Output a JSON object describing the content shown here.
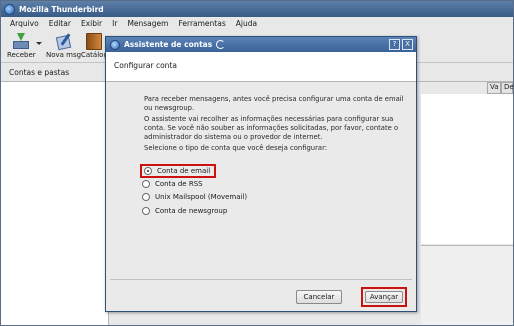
{
  "app": {
    "title": "Mozilla Thunderbird",
    "menu": [
      "Arquivo",
      "Editar",
      "Exibir",
      "Ir",
      "Mensagem",
      "Ferramentas",
      "Ajuda"
    ],
    "toolbar": {
      "receive_label": "Receber",
      "compose_label": "Nova msg",
      "addressbook_label": "Catálog"
    },
    "folder_pane_label": "Contas e pastas",
    "column_headers": [
      "Va",
      "De"
    ]
  },
  "dialog": {
    "title": "Assistente de contas",
    "controls": [
      "?",
      "X"
    ],
    "heading": "Configurar conta",
    "para1": "Para receber mensagens, antes você precisa configurar uma conta de email ou newsgroup.",
    "para2": "O assistente vai recolher as informações necessárias para configurar sua conta. Se você não souber as informações solicitadas, por favor, contate o administrador do sistema ou o provedor de internet.",
    "para3": "Selecione o tipo de conta que você deseja configurar:",
    "options": [
      {
        "label": "Conta de email",
        "selected": true
      },
      {
        "label": "Conta de RSS",
        "selected": false
      },
      {
        "label": "Unix Mailspool (Movemail)",
        "selected": false
      },
      {
        "label": "Conta de newsgroup",
        "selected": false
      }
    ],
    "cancel_label": "Cancelar",
    "next_label": "Avançar"
  },
  "highlight_color": "#cc1111"
}
